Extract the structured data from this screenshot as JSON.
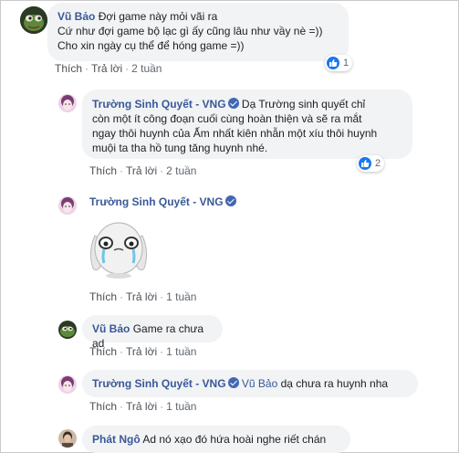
{
  "comments": [
    {
      "author": "Vũ Bảo",
      "lines": [
        "Đợi game này mỏi vãi ra",
        "Cứ như đợi game bộ lạc gì ấy cũng lâu như vầy nè =))",
        "Cho xin ngày cụ thể để hóng game =))"
      ],
      "like": "Thích",
      "reply": "Trả lời",
      "time": "2 tuần",
      "reactions": "1"
    },
    {
      "author": "Trường Sinh Quyết - VNG",
      "lines": [
        "Dạ Trường sinh quyết chỉ",
        "còn một ít công đoạn cuối cùng hoàn thiện và sẽ ra mắt",
        "ngay thôi huynh của Ấm nhất kiên nhẫn một xíu thôi huynh",
        "muội ta tha hồ tung tăng huynh nhé."
      ],
      "like": "Thích",
      "reply": "Trả lời",
      "time": "2 tuần",
      "reactions": "2"
    },
    {
      "author": "Trường Sinh Quyết - VNG",
      "sticker": "crying-bunny-sticker",
      "like": "Thích",
      "reply": "Trả lời",
      "time": "1 tuần"
    },
    {
      "author": "Vũ Bảo",
      "text": "Game ra chưa ad",
      "like": "Thích",
      "reply": "Trả lời",
      "time": "1 tuần"
    },
    {
      "author": "Trường Sinh Quyết - VNG",
      "mention": "Vũ Bảo",
      "text": "dạ chưa ra huynh nha",
      "like": "Thích",
      "reply": "Trả lời",
      "time": "1 tuần"
    },
    {
      "author": "Phát Ngô",
      "text": "Ad nó xạo đó hứa hoài nghe riết chán"
    }
  ],
  "colors": {
    "link": "#385898",
    "bubble": "#f2f3f5",
    "like": "#1877f2"
  },
  "icons": {
    "verified": "verified-badge-icon",
    "like": "thumbs-up-icon"
  }
}
